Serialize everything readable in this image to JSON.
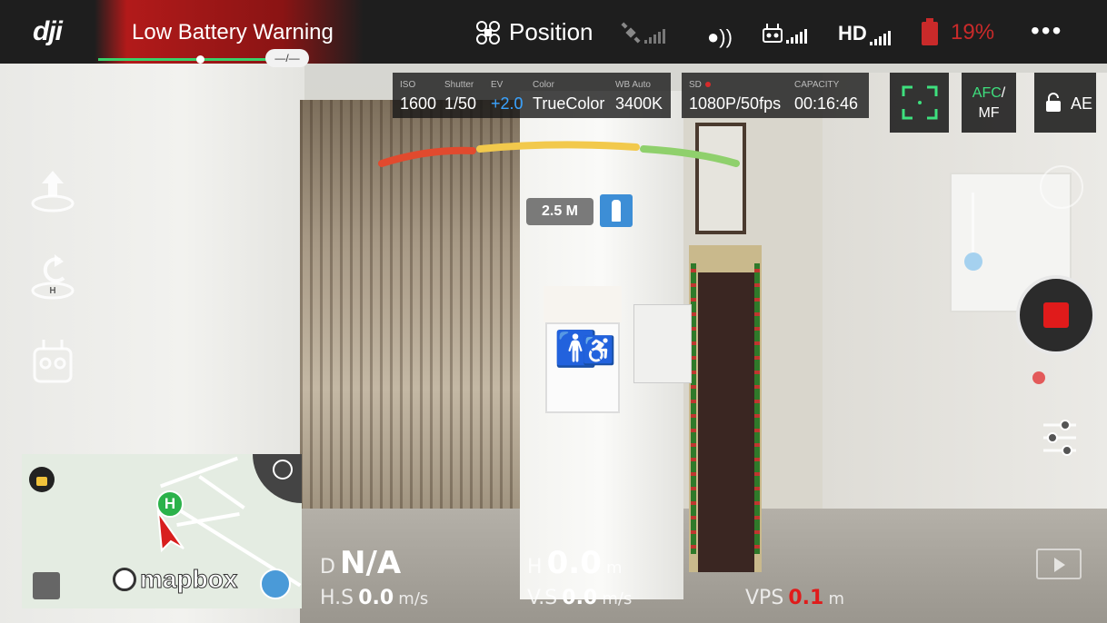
{
  "top_bar": {
    "logo": "dji",
    "warning_text": "Low Battery Warning",
    "warning_pill": "—/—",
    "flight_mode": "Position",
    "hd_label": "HD",
    "battery_percent": "19%",
    "more_glyph": "•••"
  },
  "camera_params": {
    "iso_label": "ISO",
    "iso_value": "1600",
    "shutter_label": "Shutter",
    "shutter_value": "1/50",
    "ev_label": "EV",
    "ev_value": "+2.0",
    "color_label": "Color",
    "color_value": "TrueColor",
    "wb_label": "WB Auto",
    "wb_value": "3400K",
    "sd_label": "SD",
    "capacity_label": "CAPACITY",
    "resolution_value": "1080P/50fps",
    "capacity_value": "00:16:46"
  },
  "focus_controls": {
    "afc_label": "AFC",
    "afc_sep": "/",
    "mf_label": "MF",
    "ae_label": "AE"
  },
  "obstacle": {
    "distance": "2.5 M"
  },
  "map": {
    "home_label": "H",
    "brand": "mapbox"
  },
  "telemetry": {
    "d_key": "D",
    "d_value": "N/A",
    "h_key": "H",
    "h_value": "0.0",
    "h_unit": "m",
    "hs_key": "H.S",
    "hs_value": "0.0",
    "hs_unit": "m/s",
    "vs_key": "V.S",
    "vs_value": "0.0",
    "vs_unit": "m/s",
    "vps_key": "VPS",
    "vps_value": "0.1",
    "vps_unit": "m"
  },
  "colors": {
    "accent_green": "#3ee07e",
    "warning_red": "#b21a1a",
    "battery_red": "#c92a2a",
    "ev_blue": "#3aa3ff",
    "record_red": "#e01b1b"
  }
}
